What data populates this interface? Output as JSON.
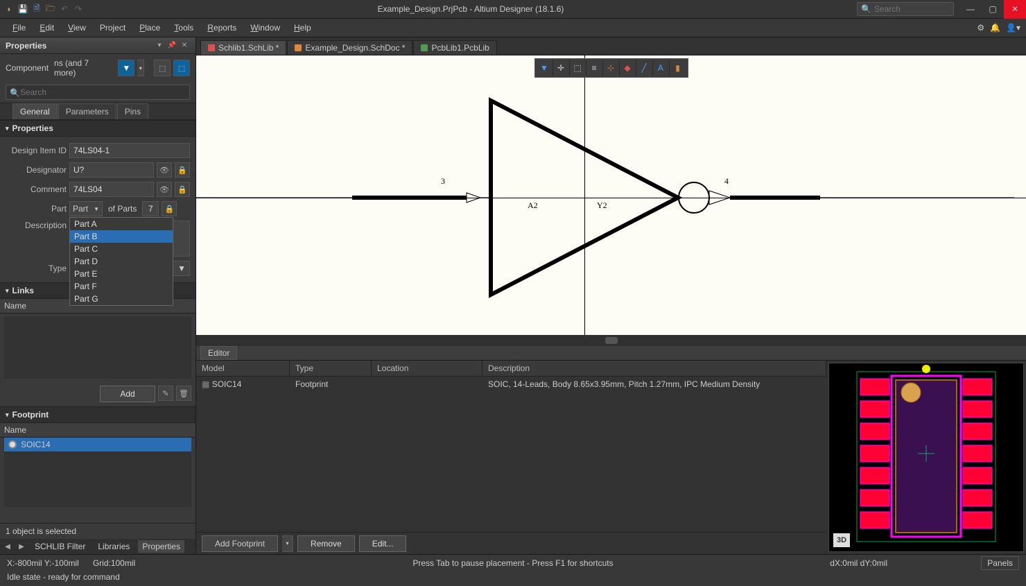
{
  "title": "Example_Design.PrjPcb - Altium Designer (18.1.6)",
  "searchPlaceholder": "Search",
  "menu": {
    "file": "File",
    "edit": "Edit",
    "view": "View",
    "project": "Project",
    "place": "Place",
    "tools": "Tools",
    "reports": "Reports",
    "window": "Window",
    "help": "Help"
  },
  "panel": {
    "title": "Properties"
  },
  "comp": {
    "label": "Component",
    "scope": "ns (and 7 more)"
  },
  "propSearch": "Search",
  "tabs": {
    "general": "General",
    "parameters": "Parameters",
    "pins": "Pins"
  },
  "section": {
    "properties": "Properties",
    "links": "Links",
    "footprint": "Footprint"
  },
  "labels": {
    "designItemId": "Design Item ID",
    "designator": "Designator",
    "comment": "Comment",
    "part": "Part",
    "ofParts": "of Parts",
    "description": "Description",
    "type": "Type",
    "name": "Name"
  },
  "vals": {
    "designItemId": "74LS04-1",
    "designator": "U?",
    "comment": "74LS04",
    "partSel": "Part",
    "ofPartsVal": "7",
    "description": ""
  },
  "partOptions": [
    "Part A",
    "Part B",
    "Part C",
    "Part D",
    "Part E",
    "Part F",
    "Part G"
  ],
  "partSelected": "Part B",
  "buttons": {
    "add": "Add",
    "addFootprint": "Add Footprint",
    "remove": "Remove",
    "edit": "Edit...",
    "panels": "Panels",
    "3d": "3D"
  },
  "footprint": {
    "item": "SOIC14"
  },
  "selStatus": "1 object is selected",
  "navTabs": {
    "schlibFilter": "SCHLIB Filter",
    "libraries": "Libraries",
    "properties": "Properties"
  },
  "docTabs": {
    "t1": "Schlib1.SchLib *",
    "t2": "Example_Design.SchDoc *",
    "t3": "PcbLib1.PcbLib"
  },
  "editor": "Editor",
  "modelHdr": {
    "model": "Model",
    "type": "Type",
    "location": "Location",
    "description": "Description"
  },
  "modelRow": {
    "model": "SOIC14",
    "type": "Footprint",
    "location": "",
    "description": "SOIC, 14-Leads, Body 8.65x3.95mm, Pitch 1.27mm, IPC Medium Density"
  },
  "schematic": {
    "pin1": "3",
    "pin2": "4",
    "labelA": "A2",
    "labelY": "Y2"
  },
  "status": {
    "xy": "X:-800mil Y:-100mil",
    "grid": "Grid:100mil",
    "hint": "Press Tab to pause placement - Press F1 for shortcuts",
    "dxy": "dX:0mil dY:0mil",
    "state": "Idle state - ready for command"
  }
}
